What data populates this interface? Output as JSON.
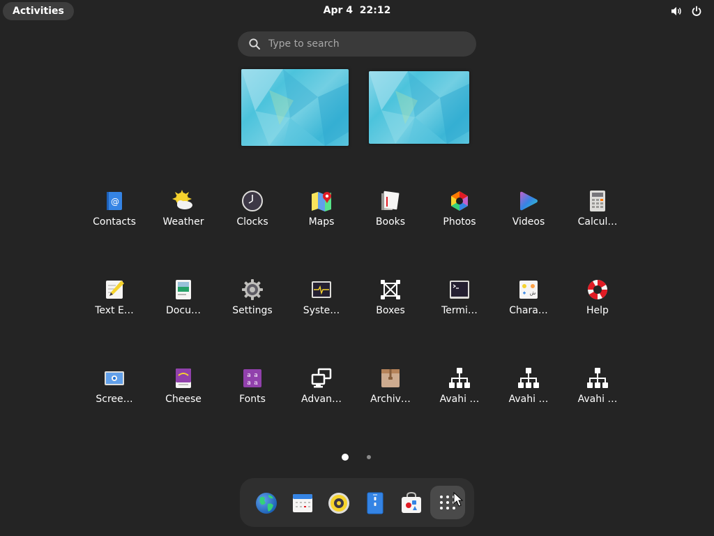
{
  "topbar": {
    "activities_label": "Activities",
    "clock": "Apr 4  22:12",
    "volume_icon": "volume-icon",
    "power_icon": "power-icon"
  },
  "search": {
    "placeholder": "Type to search",
    "icon": "search-icon"
  },
  "workspaces": [
    {
      "name": "workspace-1"
    },
    {
      "name": "workspace-2"
    }
  ],
  "apps": {
    "row1": [
      {
        "label": "Contacts",
        "icon": "contacts-icon"
      },
      {
        "label": "Weather",
        "icon": "weather-icon"
      },
      {
        "label": "Clocks",
        "icon": "clocks-icon"
      },
      {
        "label": "Maps",
        "icon": "maps-icon"
      },
      {
        "label": "Books",
        "icon": "books-icon"
      },
      {
        "label": "Photos",
        "icon": "photos-icon"
      },
      {
        "label": "Videos",
        "icon": "videos-icon"
      },
      {
        "label": "Calcul…",
        "icon": "calculator-icon"
      }
    ],
    "row2": [
      {
        "label": "Text E…",
        "icon": "text-editor-icon"
      },
      {
        "label": "Docu…",
        "icon": "document-viewer-icon"
      },
      {
        "label": "Settings",
        "icon": "settings-icon"
      },
      {
        "label": "Syste…",
        "icon": "system-monitor-icon"
      },
      {
        "label": "Boxes",
        "icon": "boxes-icon"
      },
      {
        "label": "Termi…",
        "icon": "terminal-icon"
      },
      {
        "label": "Chara…",
        "icon": "characters-icon"
      },
      {
        "label": "Help",
        "icon": "help-icon"
      }
    ],
    "row3": [
      {
        "label": "Scree…",
        "icon": "screenshot-icon"
      },
      {
        "label": "Cheese",
        "icon": "cheese-icon"
      },
      {
        "label": "Fonts",
        "icon": "fonts-icon"
      },
      {
        "label": "Advan…",
        "icon": "advanced-network-icon"
      },
      {
        "label": "Archiv…",
        "icon": "archive-manager-icon"
      },
      {
        "label": "Avahi …",
        "icon": "avahi-icon"
      },
      {
        "label": "Avahi …",
        "icon": "avahi-icon"
      },
      {
        "label": "Avahi …",
        "icon": "avahi-icon"
      }
    ]
  },
  "pager": {
    "pages": 2,
    "current": 1
  },
  "dash": [
    {
      "icon": "web-browser-icon"
    },
    {
      "icon": "calendar-icon"
    },
    {
      "icon": "music-player-icon"
    },
    {
      "icon": "file-manager-icon"
    },
    {
      "icon": "software-store-icon"
    },
    {
      "icon": "show-apps-icon"
    }
  ],
  "colors": {
    "background": "#242424",
    "panel": "#3d3d3d",
    "search": "#3a3a3a",
    "dash": "#2f2f2f"
  }
}
